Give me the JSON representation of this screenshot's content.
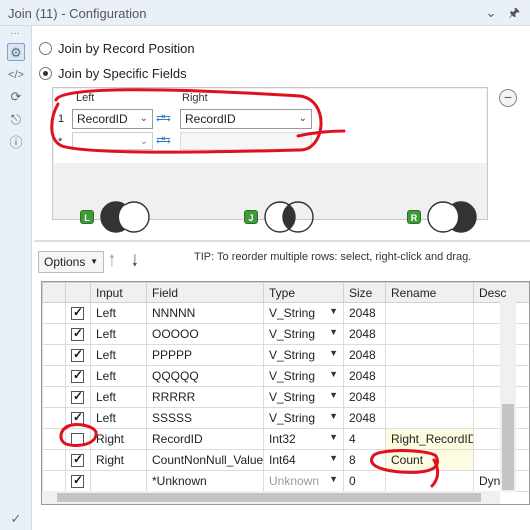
{
  "window": {
    "title": "Join (11) - Configuration"
  },
  "join_mode": {
    "by_position_label": "Join by Record Position",
    "by_fields_label": "Join by Specific Fields",
    "selected": "by_fields"
  },
  "join_fields": {
    "left_header": "Left",
    "right_header": "Right",
    "rows": [
      {
        "num": "1",
        "left": "RecordID",
        "right": "RecordID"
      },
      {
        "num": "*",
        "left": "",
        "right": ""
      }
    ]
  },
  "venn": {
    "left_tag": "L",
    "join_tag": "J",
    "right_tag": "R"
  },
  "toolbar": {
    "options_label": "Options",
    "tip": "TIP: To reorder multiple rows: select, right-click and drag."
  },
  "grid": {
    "headers": [
      "Input",
      "Field",
      "Type",
      "Size",
      "Rename",
      "Desc"
    ],
    "rows": [
      {
        "checked": true,
        "input": "Left",
        "field": "NNNNN",
        "type": "V_String",
        "size": "2048",
        "rename": ""
      },
      {
        "checked": true,
        "input": "Left",
        "field": "OOOOO",
        "type": "V_String",
        "size": "2048",
        "rename": ""
      },
      {
        "checked": true,
        "input": "Left",
        "field": "PPPPP",
        "type": "V_String",
        "size": "2048",
        "rename": ""
      },
      {
        "checked": true,
        "input": "Left",
        "field": "QQQQQ",
        "type": "V_String",
        "size": "2048",
        "rename": ""
      },
      {
        "checked": true,
        "input": "Left",
        "field": "RRRRR",
        "type": "V_String",
        "size": "2048",
        "rename": ""
      },
      {
        "checked": true,
        "input": "Left",
        "field": "SSSSS",
        "type": "V_String",
        "size": "2048",
        "rename": ""
      },
      {
        "checked": false,
        "input": "Right",
        "field": "RecordID",
        "type": "Int32",
        "size": "4",
        "rename": "Right_RecordID"
      },
      {
        "checked": true,
        "input": "Right",
        "field": "CountNonNull_Value",
        "type": "Int64",
        "size": "8",
        "rename": "Count"
      },
      {
        "checked": true,
        "input": "",
        "field": "*Unknown",
        "type": "Unknown",
        "size": "0",
        "rename": "",
        "desc": "Dyna"
      }
    ]
  },
  "colors": {
    "accent": "#3a78c8",
    "annotation": "#e0101e",
    "venn_tag": "#3f9a3a"
  }
}
